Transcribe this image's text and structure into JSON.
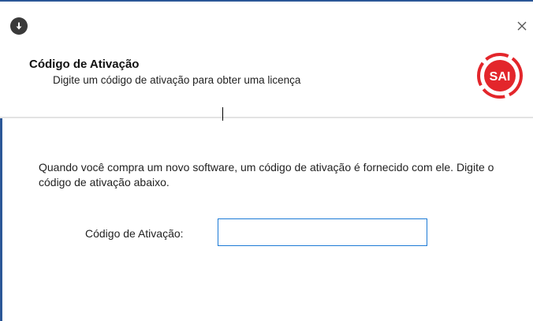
{
  "window": {
    "close_glyph": "×"
  },
  "header": {
    "title": "Código de Ativação",
    "subtitle": "Digite um código de ativação para obter uma licença",
    "logo_text": "SAI",
    "logo_color": "#e3262b"
  },
  "body": {
    "description": "Quando você compra um novo software, um código de ativação é fornecido com ele.  Digite o código de ativação abaixo.",
    "field_label": "Código de Ativação:",
    "field_value": "",
    "field_placeholder": ""
  },
  "colors": {
    "accent": "#1c7ad6",
    "window_border": "#2b5797"
  }
}
